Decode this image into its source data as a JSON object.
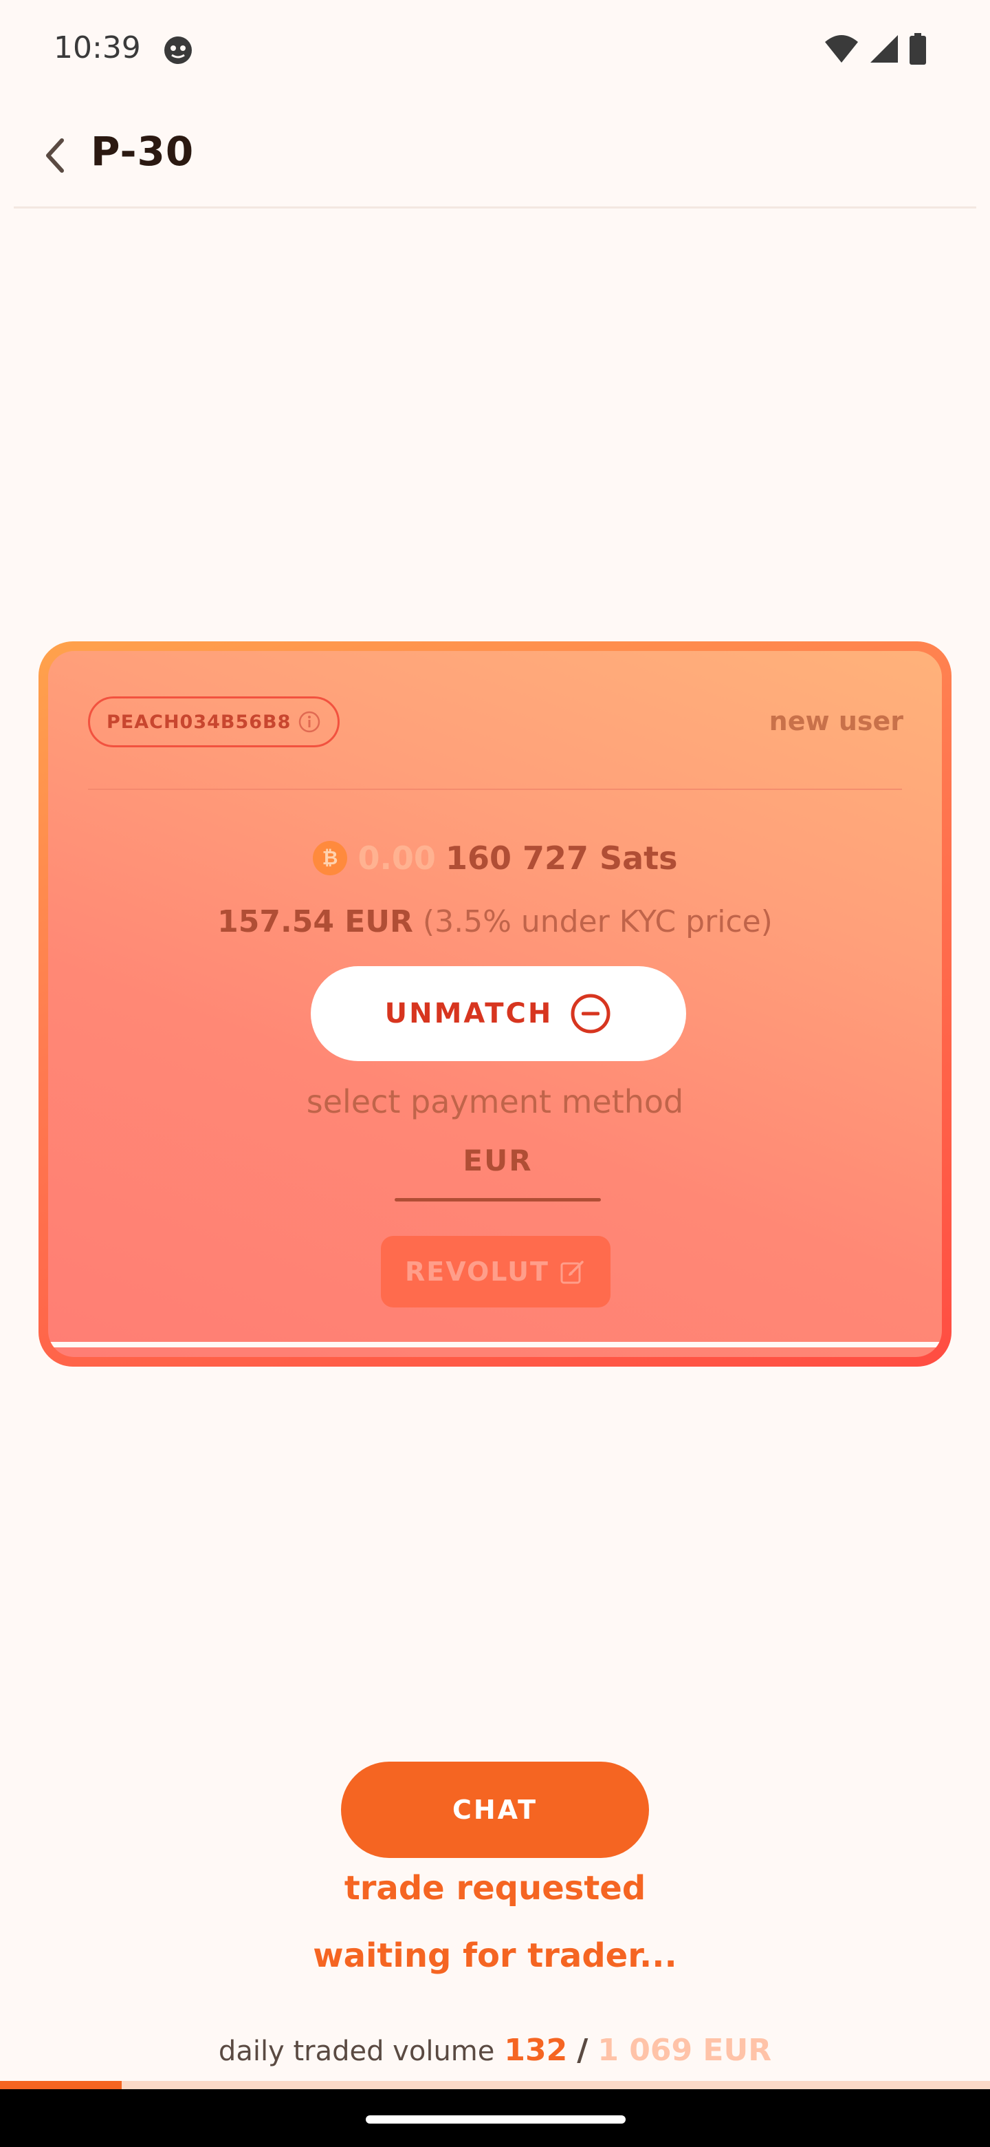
{
  "status_bar": {
    "time": "10:39",
    "icons": [
      "app-notification-icon",
      "wifi-icon",
      "cell-signal-icon",
      "battery-icon"
    ]
  },
  "header": {
    "title": "P-30",
    "back_icon": "chevron-left-icon"
  },
  "match_card": {
    "peach_id": "PEACH034B56B8",
    "user_badge": "new user",
    "amount": {
      "zeros": "0.00",
      "sats": "160 727 Sats",
      "currency_icon": "bitcoin-icon"
    },
    "price": {
      "eur": "157.54 EUR",
      "note": "(3.5% under KYC price)"
    },
    "unmatch_label": "UNMATCH",
    "select_payment_label": "select payment method",
    "currency_tab": "EUR",
    "payment_method": "REVOLUT"
  },
  "actions": {
    "chat_label": "CHAT",
    "status": "trade requested",
    "waiting": "waiting for trader..."
  },
  "daily_volume": {
    "label": "daily traded volume",
    "current": "132",
    "separator": "/",
    "max": "1 069 EUR",
    "progress_fraction": 0.123
  },
  "colors": {
    "primary": "#F56522",
    "background": "#FFF9F6",
    "unmatch": "#D7351F",
    "text_dark": "#2B1911"
  }
}
